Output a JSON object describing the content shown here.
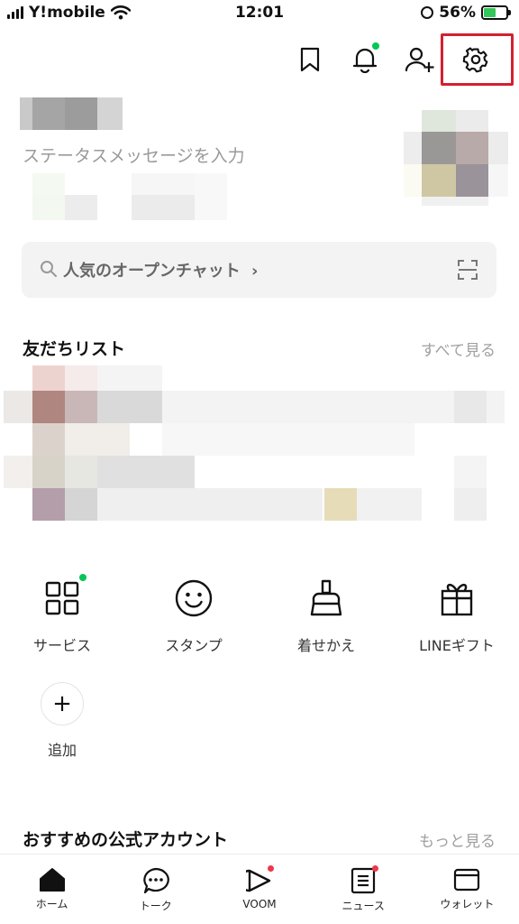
{
  "status_bar": {
    "carrier": "Y!mobile",
    "time": "12:01",
    "battery_pct": "56%",
    "battery_level": 0.56,
    "icons": [
      "signal-icon",
      "wifi-icon",
      "rotation-lock-icon",
      "battery-charging-icon"
    ]
  },
  "header": {
    "icons": [
      "bookmark-icon",
      "bell-icon",
      "add-friend-icon",
      "settings-gear-icon"
    ],
    "notification_dot_color": "#06c755",
    "highlight_color": "#d3202f"
  },
  "profile": {
    "status_message_placeholder": "ステータスメッセージを入力"
  },
  "search": {
    "label": "人気のオープンチャット",
    "chevron": "›"
  },
  "friends": {
    "title": "友だちリスト",
    "see_all": "すべて見る"
  },
  "services": {
    "items": [
      {
        "label": "サービス",
        "icon": "grid-icon"
      },
      {
        "label": "スタンプ",
        "icon": "smiley-icon"
      },
      {
        "label": "着せかえ",
        "icon": "brush-icon"
      },
      {
        "label": "LINEギフト",
        "icon": "gift-icon"
      }
    ],
    "add_label": "追加",
    "add_symbol": "+"
  },
  "official": {
    "title": "おすすめの公式アカウント",
    "see_more": "もっと見る"
  },
  "bottom_nav": {
    "items": [
      {
        "label": "ホーム",
        "icon": "home-icon",
        "active": true
      },
      {
        "label": "トーク",
        "icon": "chat-icon"
      },
      {
        "label": "VOOM",
        "icon": "voom-icon"
      },
      {
        "label": "ニュース",
        "icon": "news-icon"
      },
      {
        "label": "ウォレット",
        "icon": "wallet-icon"
      }
    ],
    "badge_color": "#f0364a"
  }
}
